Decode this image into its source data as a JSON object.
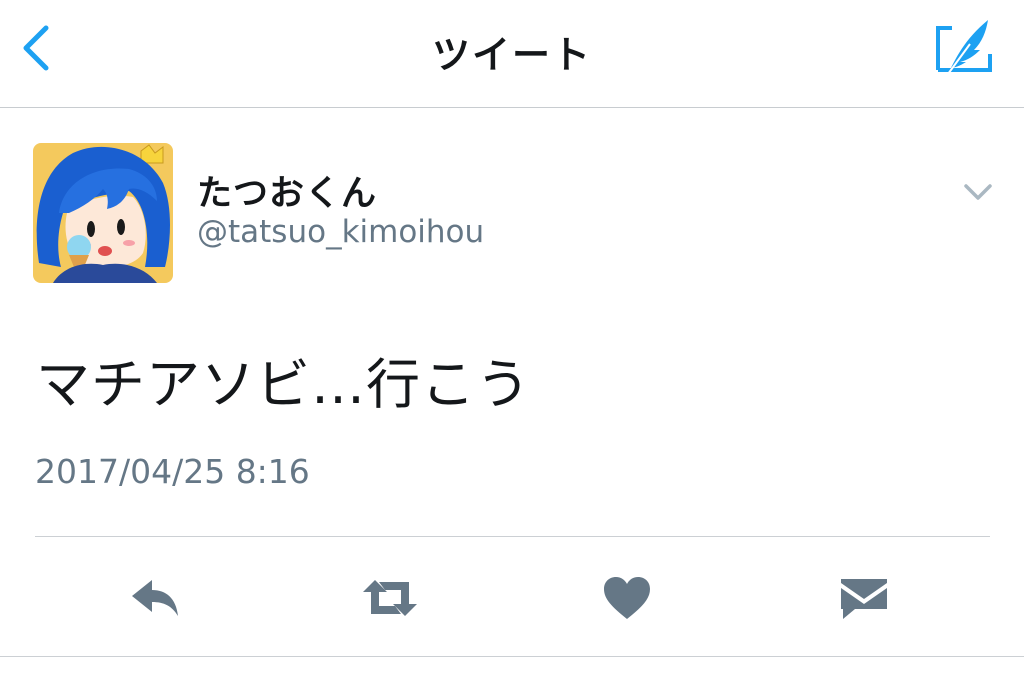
{
  "navbar": {
    "title": "ツイート",
    "back_icon": "chevron-left-icon",
    "compose_icon": "compose-quill-icon",
    "accent_color": "#1da1f2"
  },
  "tweet": {
    "display_name": "たつおくん",
    "screen_name": "@tatsuo_kimoihou",
    "text": "マチアソビ…行こう",
    "timestamp": "2017/04/25 8:16"
  },
  "actions": [
    {
      "name": "reply",
      "icon": "reply-icon"
    },
    {
      "name": "retweet",
      "icon": "retweet-icon"
    },
    {
      "name": "like",
      "icon": "heart-icon"
    },
    {
      "name": "direct-message",
      "icon": "envelope-icon"
    }
  ],
  "colors": {
    "text_primary": "#14171a",
    "text_secondary": "#657786",
    "action_icon": "#657786",
    "divider": "#ccd0d4"
  }
}
